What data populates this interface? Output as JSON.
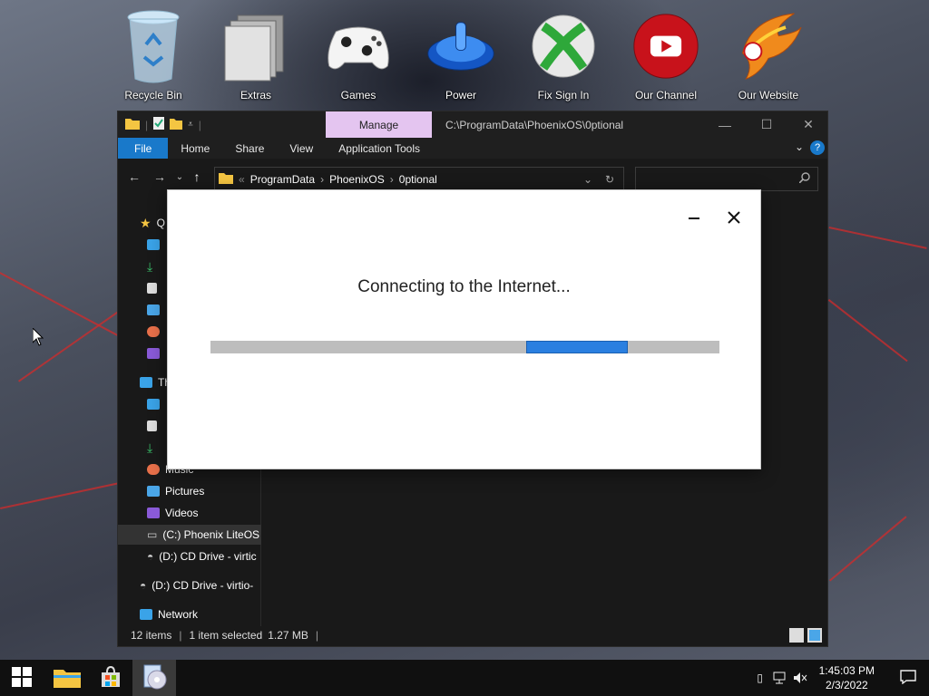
{
  "desktop": {
    "icons": [
      {
        "label": "Recycle Bin",
        "icon": "recycle-bin-icon"
      },
      {
        "label": "Extras",
        "icon": "folder-stack-icon"
      },
      {
        "label": "Games",
        "icon": "gamepad-icon"
      },
      {
        "label": "Power",
        "icon": "power-icon"
      },
      {
        "label": "Fix Sign In",
        "icon": "xbox-icon"
      },
      {
        "label": "Our Channel",
        "icon": "youtube-icon"
      },
      {
        "label": "Our Website",
        "icon": "phoenix-logo-icon"
      }
    ]
  },
  "explorer": {
    "manage_tab": "Manage",
    "title_path": "C:\\ProgramData\\PhoenixOS\\0ptional",
    "ribbon": {
      "file": "File",
      "home": "Home",
      "share": "Share",
      "view": "View",
      "app_tools": "Application Tools"
    },
    "breadcrumb": [
      "ProgramData",
      "PhoenixOS",
      "0ptional"
    ],
    "nav": {
      "quick_access": "Q",
      "this_pc": "Th",
      "music": "Music",
      "pictures": "Pictures",
      "videos": "Videos",
      "drive_c": "(C:) Phoenix LiteOS",
      "drive_d_sub": "(D:) CD Drive - virtic",
      "drive_d": "(D:) CD Drive - virtio-",
      "network": "Network"
    },
    "status": {
      "items": "12 items",
      "selected": "1 item selected",
      "size": "1.27 MB"
    }
  },
  "dialog": {
    "message": "Connecting to the Internet...",
    "progress_chunk_start": 0.62,
    "progress_chunk_width": 0.2
  },
  "taskbar": {
    "time": "1:45:03 PM",
    "date": "2/3/2022"
  },
  "colors": {
    "accent": "#1979ca",
    "manage_tab": "#e4c5f0",
    "progress": "#2a7fe0"
  }
}
